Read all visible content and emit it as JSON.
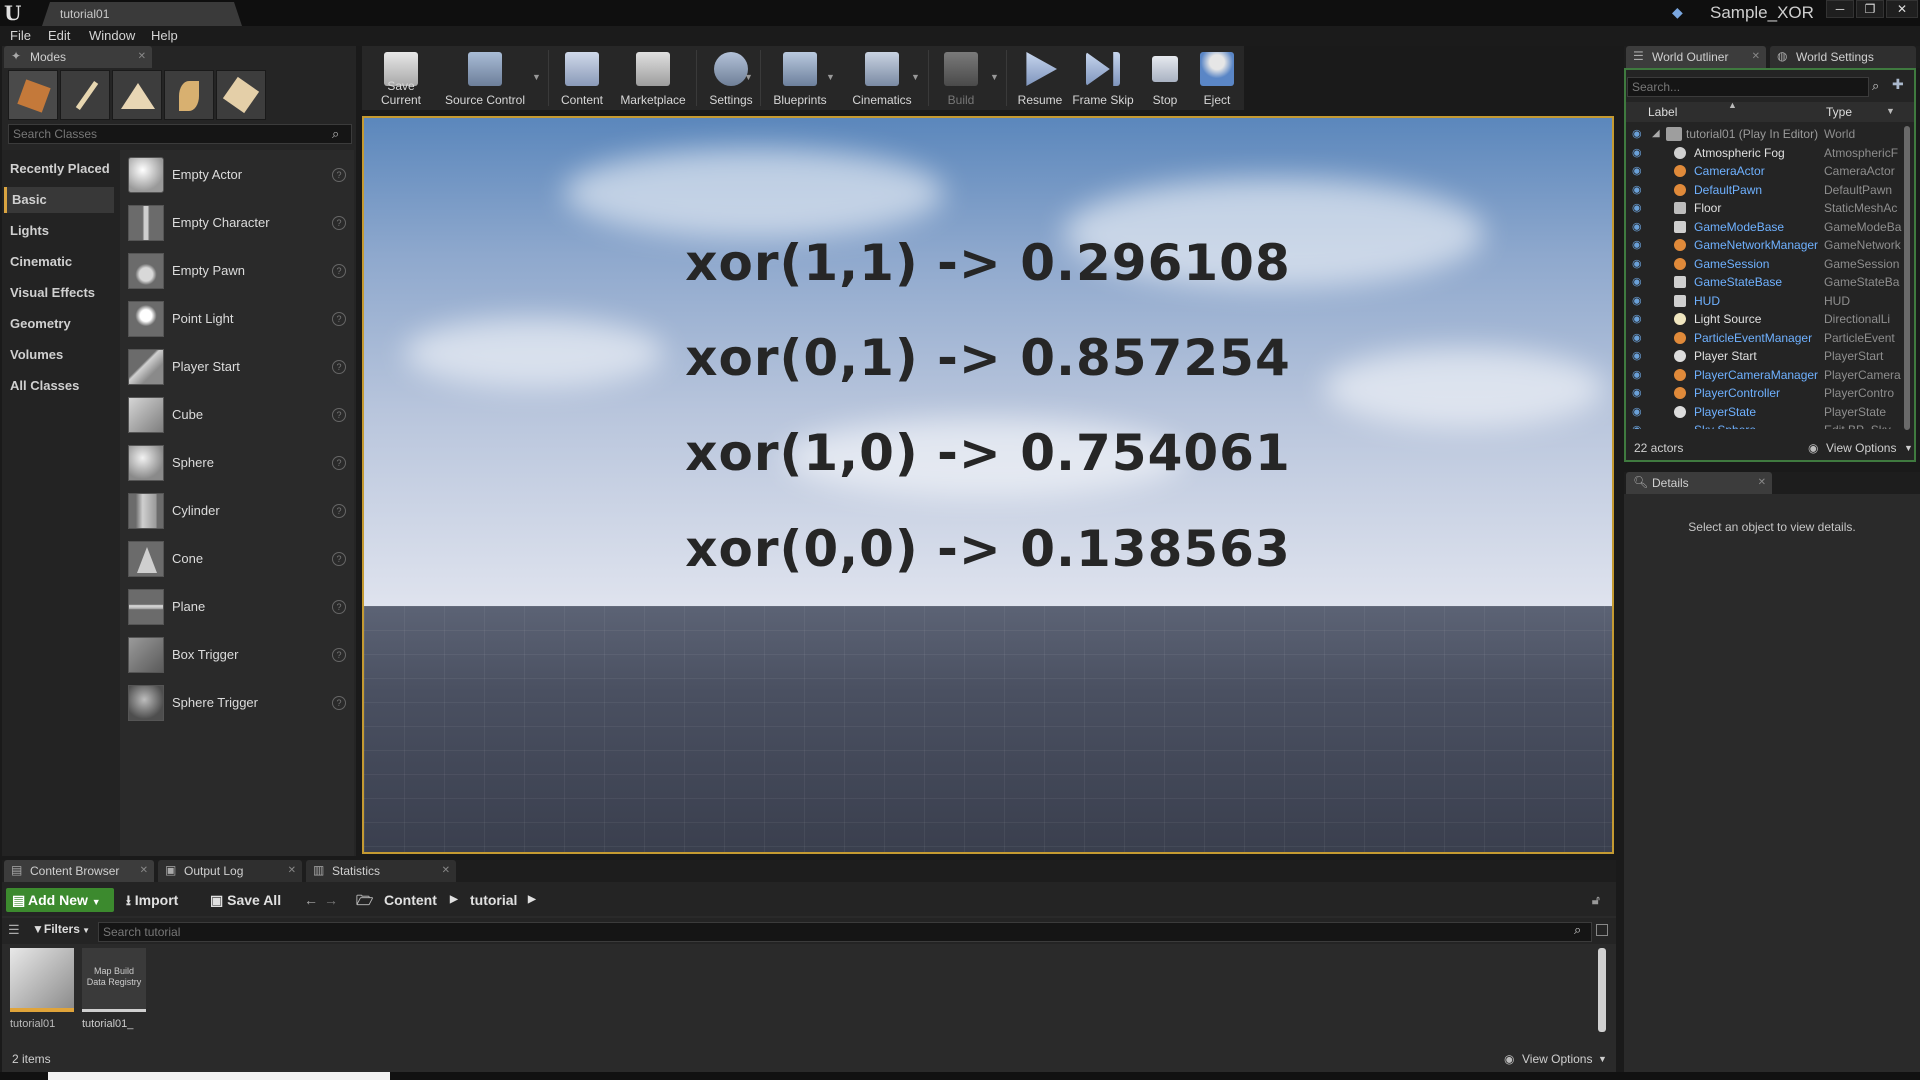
{
  "titlebar": {
    "doc_tab": "tutorial01",
    "project_name": "Sample_XOR",
    "minimize": "─",
    "restore": "❐",
    "close": "✕"
  },
  "menu": [
    "File",
    "Edit",
    "Window",
    "Help"
  ],
  "modes": {
    "tab_label": "Modes",
    "search_placeholder": "Search Classes",
    "categories": [
      "Recently Placed",
      "Basic",
      "Lights",
      "Cinematic",
      "Visual Effects",
      "Geometry",
      "Volumes",
      "All Classes"
    ],
    "active_category": "Basic",
    "classes": [
      {
        "label": "Empty Actor",
        "icon": "sphere-white"
      },
      {
        "label": "Empty Character",
        "icon": "mannequin"
      },
      {
        "label": "Empty Pawn",
        "icon": "pawn"
      },
      {
        "label": "Point Light",
        "icon": "bulb"
      },
      {
        "label": "Player Start",
        "icon": "flag"
      },
      {
        "label": "Cube",
        "icon": "cube"
      },
      {
        "label": "Sphere",
        "icon": "sphere"
      },
      {
        "label": "Cylinder",
        "icon": "cylinder"
      },
      {
        "label": "Cone",
        "icon": "cone"
      },
      {
        "label": "Plane",
        "icon": "plane"
      },
      {
        "label": "Box Trigger",
        "icon": "box-trigger"
      },
      {
        "label": "Sphere Trigger",
        "icon": "sphere-trigger"
      }
    ],
    "help_glyph": "?"
  },
  "toolbar": {
    "items": [
      "Save Current",
      "Source Control",
      "Content",
      "Marketplace",
      "Settings",
      "Blueprints",
      "Cinematics",
      "Build",
      "Resume",
      "Frame Skip",
      "Stop",
      "Eject"
    ]
  },
  "viewport": {
    "lines": [
      "xor(1,1) -> 0.296108",
      "xor(0,1) -> 0.857254",
      "xor(1,0) -> 0.754061",
      "xor(0,0) -> 0.138563"
    ]
  },
  "outliner": {
    "tab_label": "World Outliner",
    "settings_tab_label": "World Settings",
    "search_placeholder": "Search...",
    "col_label": "Label",
    "col_type": "Type",
    "rows": [
      {
        "label": "tutorial01 (Play In Editor)",
        "type": "World"
      },
      {
        "label": "Atmospheric Fog",
        "type": "AtmosphericF"
      },
      {
        "label": "CameraActor",
        "type": "CameraActor"
      },
      {
        "label": "DefaultPawn",
        "type": "DefaultPawn"
      },
      {
        "label": "Floor",
        "type": "StaticMeshAc"
      },
      {
        "label": "GameModeBase",
        "type": "GameModeBa"
      },
      {
        "label": "GameNetworkManager",
        "type": "GameNetwork"
      },
      {
        "label": "GameSession",
        "type": "GameSession"
      },
      {
        "label": "GameStateBase",
        "type": "GameStateBa"
      },
      {
        "label": "HUD",
        "type": "HUD"
      },
      {
        "label": "Light Source",
        "type": "DirectionalLi"
      },
      {
        "label": "ParticleEventManager",
        "type": "ParticleEvent"
      },
      {
        "label": "Player Start",
        "type": "PlayerStart"
      },
      {
        "label": "PlayerCameraManager",
        "type": "PlayerCamera"
      },
      {
        "label": "PlayerController",
        "type": "PlayerContro"
      },
      {
        "label": "PlayerState",
        "type": "PlayerState"
      },
      {
        "label": "Sky Sphere",
        "type": "Edit BP_Sky"
      }
    ],
    "actor_count": "22 actors",
    "view_options": "View Options"
  },
  "details": {
    "tab_label": "Details",
    "empty_message": "Select an object to view details."
  },
  "content_browser": {
    "tabs": [
      "Content Browser",
      "Output Log",
      "Statistics"
    ],
    "add_new": "Add New",
    "import": "Import",
    "save_all": "Save All",
    "breadcrumb": [
      "Content",
      "tutorial"
    ],
    "filters": "Filters",
    "search_placeholder": "Search tutorial",
    "assets": [
      {
        "name": "tutorial01",
        "thumb_text": ""
      },
      {
        "name": "tutorial01_",
        "thumb_text": "Map Build Data Registry"
      }
    ],
    "item_count": "2 items",
    "view_options": "View Options"
  }
}
